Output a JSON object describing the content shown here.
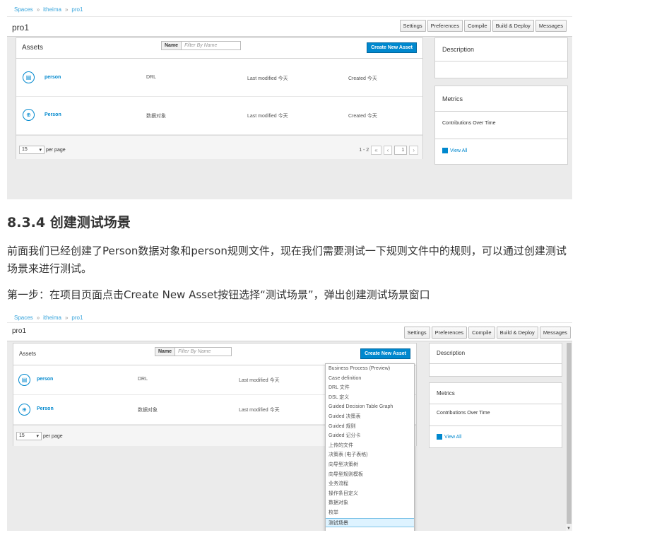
{
  "screenshot1": {
    "breadcrumbs": [
      "Spaces",
      "itheima",
      "pro1"
    ],
    "project_title": "pro1",
    "toolbar": [
      "Settings",
      "Preferences",
      "Compile",
      "Build & Deploy",
      "Messages"
    ],
    "assets": {
      "title": "Assets",
      "name_label": "Name",
      "filter_placeholder": "Filter By Name",
      "create_button": "Create New Asset",
      "rows": [
        {
          "name": "person",
          "type": "DRL",
          "modified": "Last modified 今天",
          "created": "Created 今天",
          "icon": "rule-file-icon"
        },
        {
          "name": "Person",
          "type": "数据对象",
          "modified": "Last modified 今天",
          "created": "Created 今天",
          "icon": "data-object-icon"
        }
      ],
      "per_page_value": "15",
      "per_page_label": "per page",
      "range": "1 - 2",
      "page": "1"
    },
    "side": {
      "description": "Description",
      "metrics": "Metrics",
      "contributions": "Contributions Over Time",
      "view_all": "View All"
    }
  },
  "heading": "8.3.4 创建测试场景",
  "paragraph1": "前面我们已经创建了Person数据对象和person规则文件，现在我们需要测试一下规则文件中的规则，可以通过创建测试场景来进行测试。",
  "paragraph2": "第一步：在项目页面点击Create New Asset按钮选择“测试场景”，弹出创建测试场景窗口",
  "screenshot2": {
    "breadcrumbs": [
      "Spaces",
      "itheima",
      "pro1"
    ],
    "project_title": "pro1",
    "toolbar": [
      "Settings",
      "Preferences",
      "Compile",
      "Build & Deploy",
      "Messages"
    ],
    "assets": {
      "title": "Assets",
      "name_label": "Name",
      "filter_placeholder": "Filter By Name",
      "create_button": "Create New Asset",
      "rows": [
        {
          "name": "person",
          "type": "DRL",
          "modified": "Last modified 今天"
        },
        {
          "name": "Person",
          "type": "数据对象",
          "modified": "Last modified 今天"
        }
      ],
      "per_page_value": "15",
      "per_page_label": "per page"
    },
    "side": {
      "description": "Description",
      "metrics": "Metrics",
      "contributions": "Contributions Over Time",
      "view_all": "View All"
    },
    "dropdown_items": [
      "Business Process (Preview)",
      "Case definition",
      "DRL 文件",
      "DSL 定义",
      "Guided Decision Table Graph",
      "Guided 决策表",
      "Guided 规则",
      "Guided 记分卡",
      "上传的文件",
      "决策表 (电子表格)",
      "向导型决策树",
      "向导型规则模板",
      "业务流程",
      "操作条目定义",
      "数据对象",
      "枚举",
      "测试场景"
    ],
    "dropdown_selected": "测试场景"
  }
}
